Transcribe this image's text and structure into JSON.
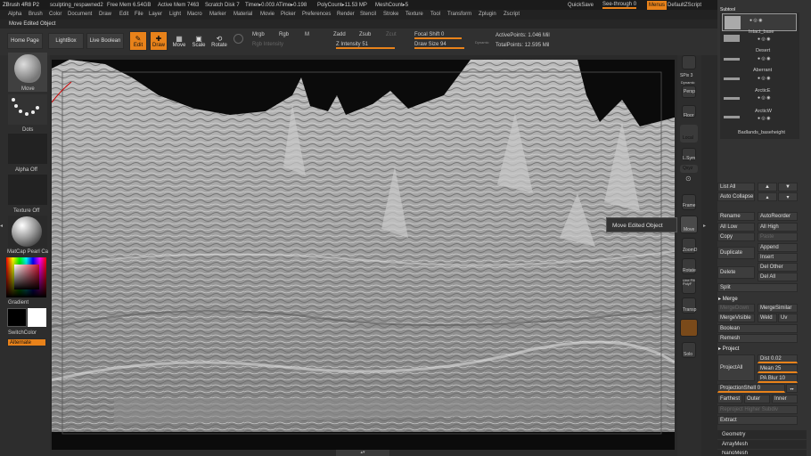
{
  "titlebar": {
    "app": "ZBrush 4R8 P2",
    "doc": "sculpting_respawned2",
    "free_mem": "Free Mem 6.54GB",
    "active_mem": "Active Mem 7463",
    "scratch": "Scratch Disk 7",
    "timer": "Timer▸0.003 ATime▸0.198",
    "polycount": "PolyCount▸11.53 MP",
    "meshcount": "MeshCount▸5",
    "quicksave": "QuickSave",
    "seethrough": "See-through 0",
    "menus": "Menus",
    "script": "DefaultZScript"
  },
  "menu": [
    "Alpha",
    "Brush",
    "Color",
    "Document",
    "Draw",
    "Edit",
    "File",
    "Layer",
    "Light",
    "Macro",
    "Marker",
    "Material",
    "Movie",
    "Picker",
    "Preferences",
    "Render",
    "Stencil",
    "Stroke",
    "Texture",
    "Tool",
    "Transform",
    "Zplugin",
    "Zscript"
  ],
  "status_text": "Move Edited Object",
  "topshelf": {
    "home_page": "Home Page",
    "lightbox": "LightBox",
    "live_boolean": "Live Boolean",
    "edit": "Edit",
    "draw": "Draw",
    "move": "Move",
    "scale": "Scale",
    "rotate": "Rotate",
    "mrgb": "Mrgb",
    "rgb": "Rgb",
    "m": "M",
    "rgb_intensity": "Rgb Intensity",
    "zadd": "Zadd",
    "zsub": "Zsub",
    "zcut": "Zcut",
    "z_intensity": "Z Intensity 51",
    "focal_shift": "Focal Shift 0",
    "draw_size": "Draw Size 94",
    "dynamic": "Dynamic",
    "active_points": "ActivePoints: 1.046 Mil",
    "total_points": "TotalPoints: 12.595 Mil"
  },
  "leftshelf": {
    "move": "Move",
    "dots": "Dots",
    "alpha_off": "Alpha Off",
    "texture_off": "Texture Off",
    "matcap": "MatCap Pearl Ca",
    "gradient": "Gradient",
    "switchcolor": "SwitchColor",
    "alternate": "Alternate"
  },
  "rightshelf": [
    "SPix 3",
    "Dynamic",
    "Persp",
    "Floor",
    "Local",
    "L.Sym",
    "Qxyz",
    "Frame",
    "Move",
    "ZoomD",
    "Rotate",
    "Line Fill PolyF",
    "Transp",
    "Solo"
  ],
  "tooltip": "Move Edited Object",
  "subtools": {
    "header": "Subtool",
    "items": [
      "Intact_base",
      "Desert",
      "Aberrant",
      "ArcticE",
      "ArcticW",
      "Badlands_baseheight"
    ]
  },
  "subtool_panel": {
    "list_all": "List All",
    "auto_collapse": "Auto Collapse",
    "rename": "Rename",
    "auto_reorder": "AutoReorder",
    "all_low": "All Low",
    "all_high": "All High",
    "copy": "Copy",
    "paste": "Paste",
    "append": "Append",
    "duplicate": "Duplicate",
    "insert": "Insert",
    "delete": "Delete",
    "del_other": "Del Other",
    "del_all": "Del All",
    "split": "Split",
    "merge": "Merge",
    "merge_down": "MergeDown",
    "merge_similar": "MergeSimilar",
    "merge_visible": "MergeVisible",
    "weld": "Weld",
    "uv": "Uv",
    "boolean": "Boolean",
    "remesh": "Remesh",
    "project": "Project",
    "project_all": "ProjectAll",
    "dist": "Dist 0.02",
    "mean": "Mean 25",
    "pa_blur": "PA Blur 10",
    "projection_shell": "ProjectionShell 0",
    "farthest": "Farthest",
    "outer": "Outer",
    "inner": "Inner",
    "reproject": "Reproject Higher Subdiv",
    "extract": "Extract",
    "geometry": "Geometry",
    "arraymesh": "ArrayMesh",
    "nanomesh": "NanoMesh"
  },
  "colors": {
    "accent": "#e8821a",
    "bg": "#2a2a2a",
    "panel": "#333333"
  }
}
